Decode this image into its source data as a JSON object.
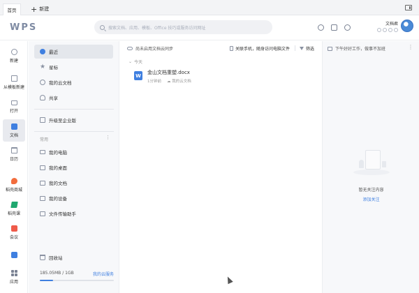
{
  "tabs": {
    "home": "首页",
    "new_tab": "新建"
  },
  "header": {
    "logo": "WPS",
    "search_placeholder": "搜索文档、应用、模板、Office 技巧或服务访问网址",
    "user_name": "文档君"
  },
  "leftbar": {
    "items": [
      {
        "label": "新建",
        "icon": "plus-circle-icon"
      },
      {
        "label": "从模板新建",
        "icon": "template-icon"
      },
      {
        "label": "打开",
        "icon": "folder-icon"
      },
      {
        "label": "文档",
        "icon": "document-icon",
        "active": true
      },
      {
        "label": "日历",
        "icon": "calendar-icon"
      },
      {
        "label": "稻壳商城",
        "icon": "docer-icon"
      },
      {
        "label": "稻壳课",
        "icon": "course-icon"
      },
      {
        "label": "会议",
        "icon": "meeting-icon"
      },
      {
        "label": "",
        "icon": "chart-icon"
      },
      {
        "label": "应用",
        "icon": "apps-icon"
      }
    ]
  },
  "nav": {
    "items": [
      {
        "label": "最近",
        "active": true
      },
      {
        "label": "星标"
      },
      {
        "label": "我的云文档"
      },
      {
        "label": "共享"
      },
      {
        "label": "升级至企业版"
      }
    ],
    "section_title": "常用",
    "section_more": "⋮",
    "common": [
      {
        "label": "我的电脑"
      },
      {
        "label": "我的桌面"
      },
      {
        "label": "我的文档"
      },
      {
        "label": "我的设备"
      },
      {
        "label": "文件传输助手"
      }
    ],
    "trash": "回收站",
    "storage": {
      "used": "185.05MB / 1GB",
      "link": "我的云服务",
      "fraction": 0.18
    }
  },
  "main": {
    "sync_notice": "尚未启用文档云同步",
    "phone_access": "关联手机，随身访问电脑文件",
    "filter": "筛选",
    "group_label": "今天",
    "files": [
      {
        "name": "金山文档重塑.docx",
        "time": "1分钟前",
        "location": "我的云文档",
        "type_letter": "W"
      }
    ]
  },
  "right": {
    "greeting": "下午好好工作，做事不加班",
    "more": "⋮",
    "empty_text": "暂无关注内容",
    "empty_link": "添加关注"
  },
  "colors": {
    "accent": "#3f7fe0",
    "background": "#ffffff"
  }
}
